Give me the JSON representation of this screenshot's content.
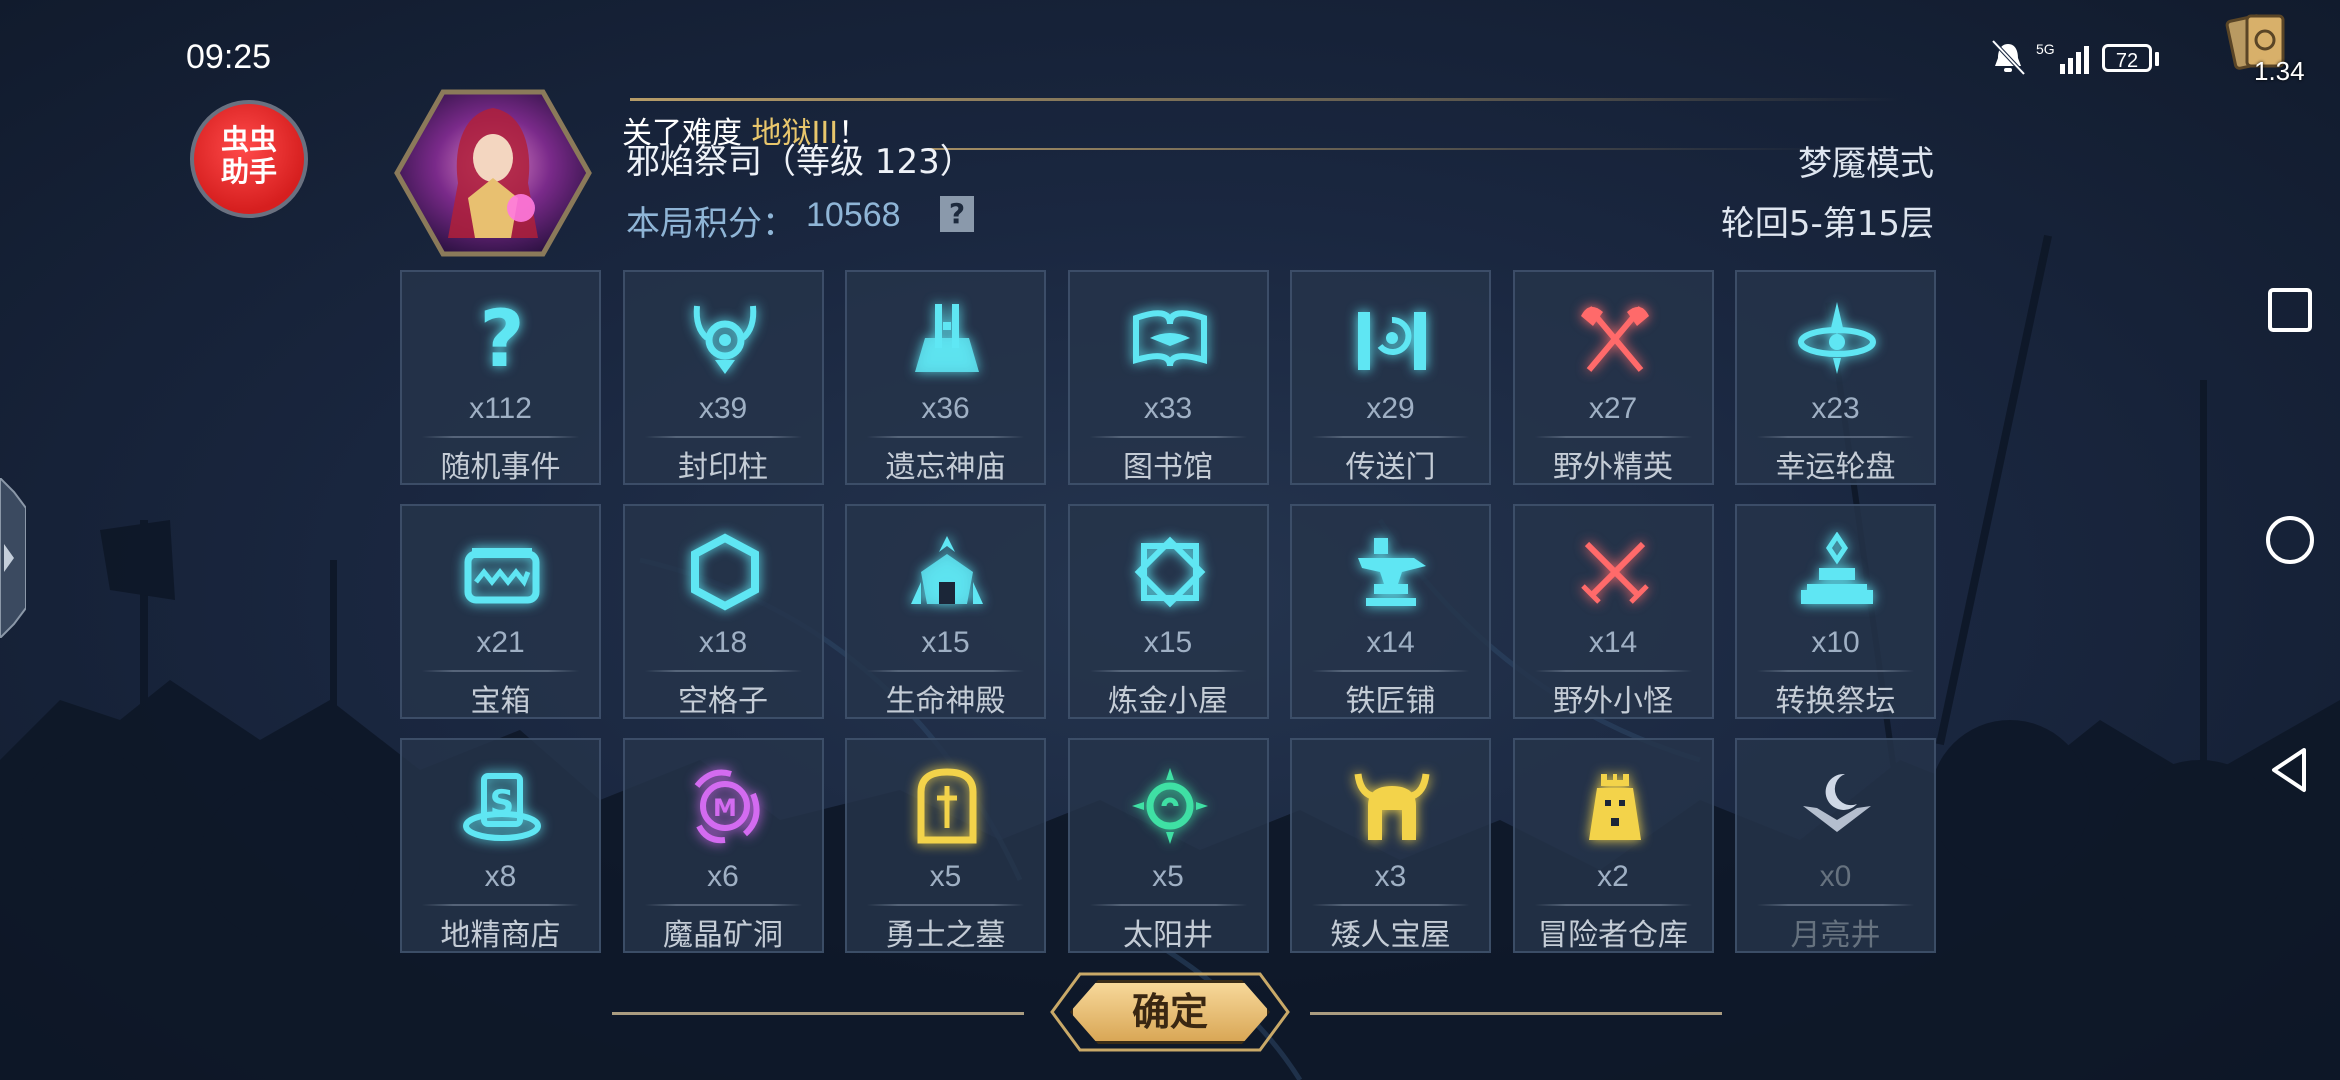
{
  "status_bar": {
    "time": "09:25",
    "network": "5G",
    "battery": "72",
    "corner_count": "1.34"
  },
  "helper": {
    "label_line1": "虫虫",
    "label_line2": "助手"
  },
  "header": {
    "notice_prefix": "关了难度",
    "notice_highlight": "地狱III",
    "notice_suffix": "！",
    "hero_name": "邪焰祭司（等级 123）",
    "score_label": "本局积分：",
    "score_value": "10568",
    "help_label": "?",
    "mode": "梦魇模式",
    "level": "轮回5-第15层"
  },
  "tiles": [
    {
      "count": "x112",
      "name": "随机事件",
      "icon": "question-icon",
      "color": "#5fe6f3"
    },
    {
      "count": "x39",
      "name": "封印柱",
      "icon": "seal-pillar-icon",
      "color": "#5fe6f3"
    },
    {
      "count": "x36",
      "name": "遗忘神庙",
      "icon": "forgotten-temple-icon",
      "color": "#5fe6f3"
    },
    {
      "count": "x33",
      "name": "图书馆",
      "icon": "library-book-icon",
      "color": "#5fe6f3"
    },
    {
      "count": "x29",
      "name": "传送门",
      "icon": "portal-icon",
      "color": "#5fe6f3"
    },
    {
      "count": "x27",
      "name": "野外精英",
      "icon": "crossed-axes-icon",
      "color": "#ff6a6a"
    },
    {
      "count": "x23",
      "name": "幸运轮盘",
      "icon": "lucky-wheel-icon",
      "color": "#5fe6f3"
    },
    {
      "count": "x21",
      "name": "宝箱",
      "icon": "treasure-chest-icon",
      "color": "#5fe6f3"
    },
    {
      "count": "x18",
      "name": "空格子",
      "icon": "hexagon-icon",
      "color": "#5fe6f3"
    },
    {
      "count": "x15",
      "name": "生命神殿",
      "icon": "life-temple-icon",
      "color": "#5fe6f3"
    },
    {
      "count": "x15",
      "name": "炼金小屋",
      "icon": "alchemy-icon",
      "color": "#5fe6f3"
    },
    {
      "count": "x14",
      "name": "铁匠铺",
      "icon": "anvil-icon",
      "color": "#5fe6f3"
    },
    {
      "count": "x14",
      "name": "野外小怪",
      "icon": "crossed-swords-icon",
      "color": "#ff6a6a"
    },
    {
      "count": "x10",
      "name": "转换祭坛",
      "icon": "altar-icon",
      "color": "#5fe6f3"
    },
    {
      "count": "x8",
      "name": "地精商店",
      "icon": "goblin-shop-icon",
      "color": "#5fe6f3"
    },
    {
      "count": "x6",
      "name": "魔晶矿洞",
      "icon": "crystal-mine-icon",
      "color": "#d36bf0"
    },
    {
      "count": "x5",
      "name": "勇士之墓",
      "icon": "tomb-icon",
      "color": "#f3d34a"
    },
    {
      "count": "x5",
      "name": "太阳井",
      "icon": "sun-well-icon",
      "color": "#3fe0a4"
    },
    {
      "count": "x3",
      "name": "矮人宝屋",
      "icon": "dwarf-helmet-icon",
      "color": "#f3d34a"
    },
    {
      "count": "x2",
      "name": "冒险者仓库",
      "icon": "warehouse-icon",
      "color": "#f3d34a"
    },
    {
      "count": "x0",
      "name": "月亮井",
      "icon": "moon-well-icon",
      "color": "#cfd8e6"
    }
  ],
  "confirm": {
    "label": "确定"
  }
}
